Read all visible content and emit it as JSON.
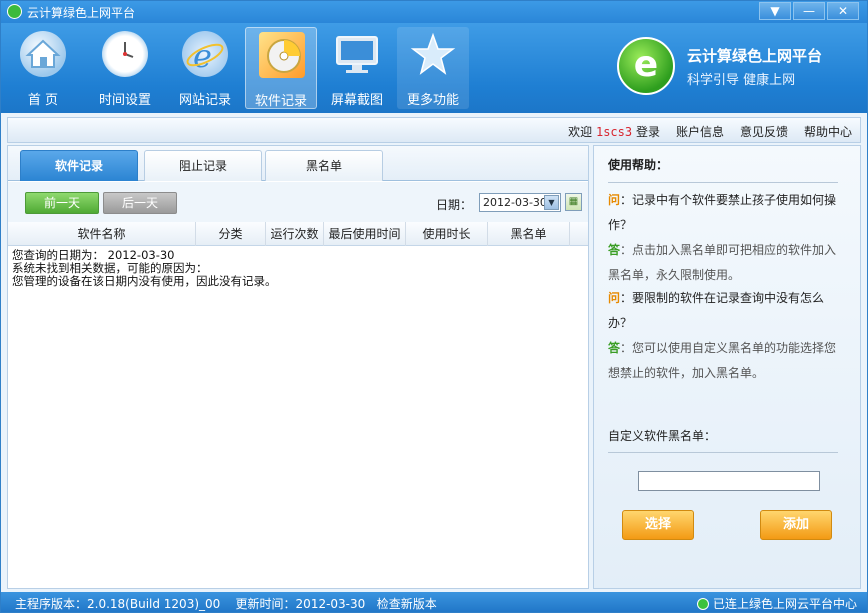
{
  "window": {
    "title": "云计算绿色上网平台",
    "buttons": [
      "▼",
      "—",
      "✕"
    ]
  },
  "nav": {
    "items": [
      {
        "label": "首  页",
        "icon": "house-icon"
      },
      {
        "label": "时间设置",
        "icon": "clock-icon"
      },
      {
        "label": "网站记录",
        "icon": "ie-browser-icon"
      },
      {
        "label": "软件记录",
        "icon": "disc-icon",
        "active": true
      },
      {
        "label": "屏幕截图",
        "icon": "monitor-icon"
      },
      {
        "label": "更多功能",
        "icon": "star-icon"
      }
    ]
  },
  "brand": {
    "title": "云计算绿色上网平台",
    "slogan": "科学引导 健康上网",
    "logo_letter": "e"
  },
  "topbar": {
    "welcome": "欢迎",
    "user": "1scs3",
    "login": "登录",
    "account": "账户信息",
    "feedback": "意见反馈",
    "help": "帮助中心"
  },
  "tabs": {
    "software_records": "软件记录",
    "blocked_records": "阻止记录",
    "blacklist": "黑名单"
  },
  "toolbar": {
    "prev_day": "前一天",
    "next_day": "后一天",
    "date_label": "日期：",
    "date_value": "2012-03-30"
  },
  "table": {
    "columns": [
      "软件名称",
      "分类",
      "运行次数",
      "最后使用时间",
      "使用时长",
      "黑名单"
    ]
  },
  "message": {
    "line1": "您查询的日期为： 2012-03-30",
    "line2": "系统未找到相关数据，可能的原因为：",
    "line3": "您管理的设备在该日期内没有使用，因此没有记录。"
  },
  "help_panel": {
    "title": "使用帮助：",
    "q_tag": "问",
    "a_tag": "答",
    "q1": "：记录中有个软件要禁止孩子使用如何操作？",
    "a1": "：点击加入黑名单即可把相应的软件加入黑名单，永久限制使用。",
    "q2": "：要限制的软件在记录查询中没有怎么办？",
    "a2": "：您可以使用自定义黑名单的功能选择您想禁止的软件，加入黑名单。",
    "custom_title": "自定义软件黑名单：",
    "select_button": "选择",
    "add_button": "添加"
  },
  "status": {
    "version": "主程序版本：2.0.18(Build 1203)_00",
    "update_time": "更新时间：2012-03-30",
    "check_update": "检查新版本",
    "connection": "已连上绿色上网云平台中心"
  }
}
